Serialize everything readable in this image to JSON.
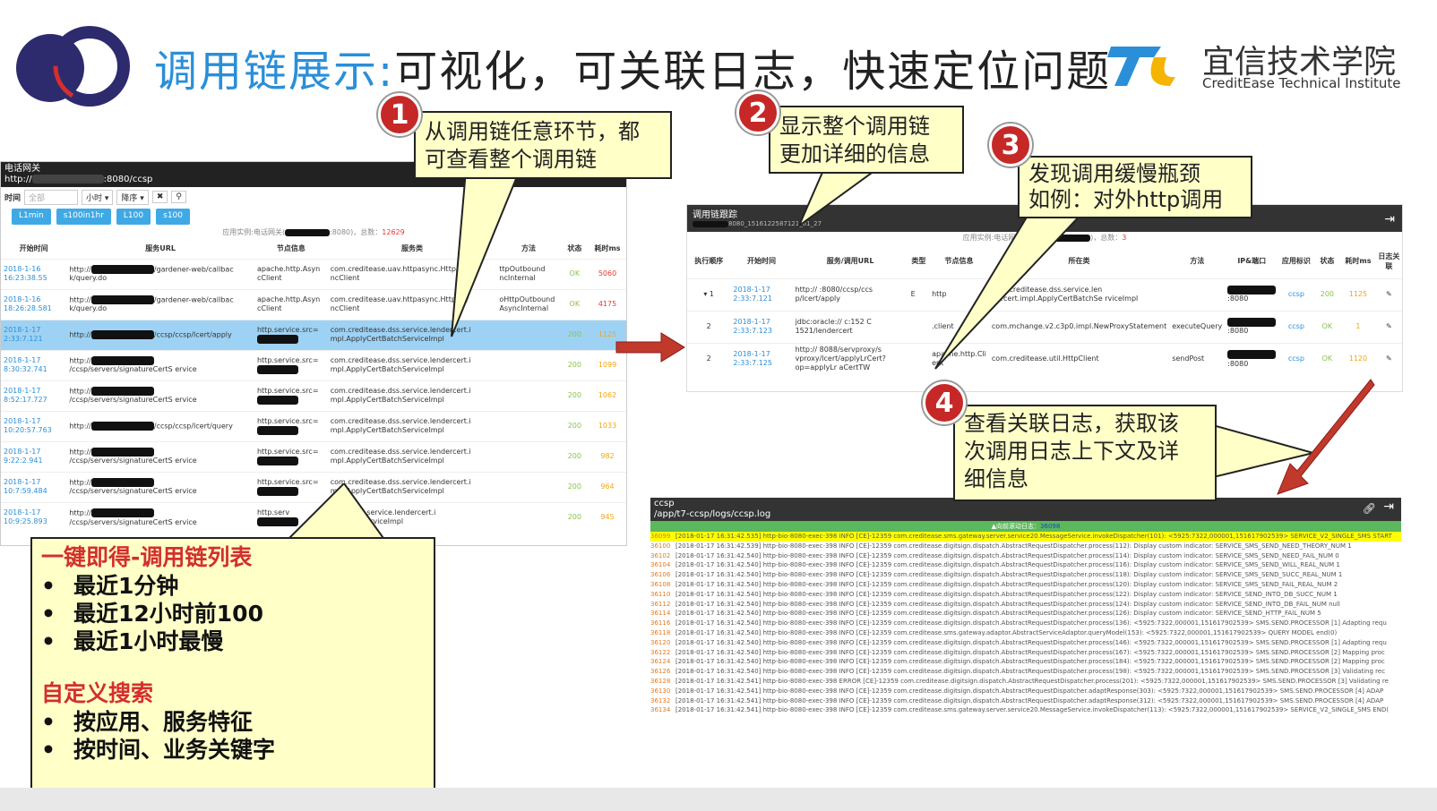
{
  "header": {
    "title_highlight": "调用链展示:",
    "title_rest": "可视化，可关联日志，快速定位问题",
    "brand_name": "宜信技术学院",
    "brand_sub": "CreditEase Technical Institute"
  },
  "panel1": {
    "head_line1": "电话网关",
    "head_line2_prefix": "http://",
    "head_line2_suffix": ":8080/ccsp",
    "search_label": "时间",
    "search_placeholder": "全部",
    "select_unit": "小时",
    "select_order": "降序",
    "quick_buttons": [
      "L1min",
      "s100in1hr",
      "L100",
      "s100"
    ],
    "info_prefix": "应用实例:电话网关(",
    "info_suffix": ":8080)，总数：",
    "info_total": "12629",
    "columns": [
      "开始时间",
      "服务URL",
      "节点信息",
      "服务类",
      "方法",
      "状态",
      "耗时ms"
    ],
    "rows": [
      {
        "time": "2018-1-16 16:23:38.55",
        "url_end": "/gardener-web/callbac k/query.do",
        "node": "apache.http.Asyn cClient",
        "cls": "com.creditease.uav.httpasync.HttpAsy ncClient",
        "method": "ttpOutbound ncInternal",
        "status": "OK",
        "ms": "5060",
        "sel": false
      },
      {
        "time": "2018-1-16 18:26:28.581",
        "url_end": "/gardener-web/callbac k/query.do",
        "node": "apache.http.Asyn cClient",
        "cls": "com.creditease.uav.httpasync.HttpAsy ncClient",
        "method": "oHttpOutbound AsyncInternal",
        "status": "OK",
        "ms": "4175",
        "sel": false
      },
      {
        "time": "2018-1-17 2:33:7.121",
        "url_end": "/ccsp/ccsp/lcert/apply",
        "node": "http.service.src=",
        "cls": "com.creditease.dss.service.lendercert.i mpl.ApplyCertBatchServiceImpl",
        "method": "",
        "status": "200",
        "ms": "1125",
        "sel": true
      },
      {
        "time": "2018-1-17 8:30:32.741",
        "url_end": "/ccsp/servers/signatureCertS ervice",
        "node": "http.service.src=",
        "cls": "com.creditease.dss.service.lendercert.i mpl.ApplyCertBatchServiceImpl",
        "method": "",
        "status": "200",
        "ms": "1099",
        "sel": false
      },
      {
        "time": "2018-1-17 8:52:17.727",
        "url_end": "/ccsp/servers/signatureCertS ervice",
        "node": "http.service.src=",
        "cls": "com.creditease.dss.service.lendercert.i mpl.ApplyCertBatchServiceImpl",
        "method": "",
        "status": "200",
        "ms": "1062",
        "sel": false
      },
      {
        "time": "2018-1-17 10:20:57.763",
        "url_end": "/ccsp/ccsp/lcert/query",
        "node": "http.service.src=",
        "cls": "com.creditease.dss.service.lendercert.i mpl.ApplyCertBatchServiceImpl",
        "method": "",
        "status": "200",
        "ms": "1033",
        "sel": false
      },
      {
        "time": "2018-1-17 9:22:2.941",
        "url_end": "/ccsp/servers/signatureCertS ervice",
        "node": "http.service.src=",
        "cls": "com.creditease.dss.service.lendercert.i mpl.ApplyCertBatchServiceImpl",
        "method": "",
        "status": "200",
        "ms": "982",
        "sel": false
      },
      {
        "time": "2018-1-17 10:7:59.484",
        "url_end": "/ccsp/servers/signatureCertS ervice",
        "node": "http.service.src=",
        "cls": "com.creditease.dss.service.lendercert.i mpl.ApplyCertBatchServiceImpl",
        "method": "",
        "status": "200",
        "ms": "964",
        "sel": false
      },
      {
        "time": "2018-1-17 10:9:25.893",
        "url_end": "/ccsp/servers/signatureCertS ervice",
        "node": "http.serv",
        "cls": "tease.dss.service.lendercert.i ertBatchServiceImpl",
        "method": "",
        "status": "200",
        "ms": "945",
        "sel": false
      }
    ]
  },
  "panel2": {
    "head_title": "调用链跟踪",
    "head_sub": "8080_1516122587121_61_27",
    "info_prefix": "应用实例:电话网关(10.",
    "info_suffix": ")，总数：",
    "info_total": "3",
    "columns": [
      "执行顺序",
      "开始时间",
      "服务/调用URL",
      "类型",
      "节点信息",
      "所在类",
      "方法",
      "IP&端口",
      "应用标识",
      "状态",
      "耗时ms",
      "日志关联"
    ],
    "rows": [
      {
        "seq": "▾ 1",
        "time": "2018-1-17 2:33:7.121",
        "url": "http:// :8080/ccsp/ccs p/lcert/apply",
        "type": "E",
        "node": "http",
        "cls": "com.creditease.dss.service.len dercert.impl.ApplyCertBatchSe rviceImpl",
        "method": "",
        "ip": ":8080",
        "app": "ccsp",
        "status": "200",
        "ms": "1125"
      },
      {
        "seq": "2",
        "time": "2018-1-17 2:33:7.123",
        "url": "jdbc:oracle:// c:152 C 1521/lendercert",
        "type": "",
        "node": ".client",
        "cls": "com.mchange.v2.c3p0.impl.NewProxyStatement",
        "method": "executeQuery",
        "ip": ":8080",
        "app": "ccsp",
        "status": "OK",
        "ms": "1"
      },
      {
        "seq": "2",
        "time": "2018-1-17 2:33:7.125",
        "url": "http:// 8088/servproxy/s vproxy/lcert/applyLrCert?op=applyLr aCertTW",
        "type": "",
        "node": "apache.http.Cli ent",
        "cls": "com.creditease.util.HttpClient",
        "method": "sendPost",
        "ip": ":8080",
        "app": "ccsp",
        "status": "OK",
        "ms": "1120"
      }
    ]
  },
  "panel3": {
    "head_app": "ccsp",
    "head_path": "/app/t7-ccsp/logs/ccsp.log",
    "bar_prefix": "向前滚动日志：",
    "bar_value": "36098",
    "logs": [
      {
        "n": "36099",
        "t": "[2018-01-17 16:31:42.535] http-bio-8080-exec-398 INFO [CE]-12359 com.creditease.sms.gateway.server.service20.MessageService.invokeDispatcher(101): <5925:7322,000001,151617902539> SERVICE_V2_SINGLE_SMS START",
        "hl": true
      },
      {
        "n": "36100",
        "t": "[2018-01-17 16:31:42.539] http-bio-8080-exec-398 INFO [CE]-12359 com.creditease.digitsign.dispatch.AbstractRequestDispatcher.process(112): Display custom indicator: SERVICE_SMS_SEND_NEED_THEORY_NUM 1",
        "hl": false
      },
      {
        "n": "36102",
        "t": "[2018-01-17 16:31:42.540] http-bio-8080-exec-398 INFO [CE]-12359 com.creditease.digitsign.dispatch.AbstractRequestDispatcher.process(114): Display custom indicator: SERVICE_SMS_SEND_NEED_FAIL_NUM 0",
        "hl": false
      },
      {
        "n": "36104",
        "t": "[2018-01-17 16:31:42.540] http-bio-8080-exec-398 INFO [CE]-12359 com.creditease.digitsign.dispatch.AbstractRequestDispatcher.process(116): Display custom indicator: SERVICE_SMS_SEND_WILL_REAL_NUM 1",
        "hl": false
      },
      {
        "n": "36106",
        "t": "[2018-01-17 16:31:42.540] http-bio-8080-exec-398 INFO [CE]-12359 com.creditease.digitsign.dispatch.AbstractRequestDispatcher.process(118): Display custom indicator: SERVICE_SMS_SEND_SUCC_REAL_NUM 1",
        "hl": false
      },
      {
        "n": "36108",
        "t": "[2018-01-17 16:31:42.540] http-bio-8080-exec-398 INFO [CE]-12359 com.creditease.digitsign.dispatch.AbstractRequestDispatcher.process(120): Display custom indicator: SERVICE_SMS_SEND_FAIL_REAL_NUM 2",
        "hl": false
      },
      {
        "n": "36110",
        "t": "[2018-01-17 16:31:42.540] http-bio-8080-exec-398 INFO [CE]-12359 com.creditease.digitsign.dispatch.AbstractRequestDispatcher.process(122): Display custom indicator: SERVICE_SEND_INTO_DB_SUCC_NUM 1",
        "hl": false
      },
      {
        "n": "36112",
        "t": "[2018-01-17 16:31:42.540] http-bio-8080-exec-398 INFO [CE]-12359 com.creditease.digitsign.dispatch.AbstractRequestDispatcher.process(124): Display custom indicator: SERVICE_SEND_INTO_DB_FAIL_NUM null",
        "hl": false
      },
      {
        "n": "36114",
        "t": "[2018-01-17 16:31:42.540] http-bio-8080-exec-398 INFO [CE]-12359 com.creditease.digitsign.dispatch.AbstractRequestDispatcher.process(126): Display custom indicator: SERVICE_SEND_HTTP_FAIL_NUM 5",
        "hl": false
      },
      {
        "n": "36116",
        "t": "[2018-01-17 16:31:42.540] http-bio-8080-exec-398 INFO [CE]-12359 com.creditease.digitsign.dispatch.AbstractRequestDispatcher.process(136): <5925:7322,000001,151617902539> SMS.SEND.PROCESSOR [1] Adapting requ",
        "hl": false
      },
      {
        "n": "36118",
        "t": "[2018-01-17 16:31:42.540] http-bio-8080-exec-398 INFO [CE]-12359 com.creditease.sms.gateway.adaptor.AbstractServiceAdaptor.queryModel(153): <5925:7322,000001,151617902539> QUERY MODEL end(0)",
        "hl": false
      },
      {
        "n": "36120",
        "t": "[2018-01-17 16:31:42.540] http-bio-8080-exec-398 INFO [CE]-12359 com.creditease.digitsign.dispatch.AbstractRequestDispatcher.process(146): <5925:7322,000001,151617902539> SMS.SEND.PROCESSOR [1] Adapting requ",
        "hl": false
      },
      {
        "n": "36122",
        "t": "[2018-01-17 16:31:42.540] http-bio-8080-exec-398 INFO [CE]-12359 com.creditease.digitsign.dispatch.AbstractRequestDispatcher.process(167): <5925:7322,000001,151617902539> SMS.SEND.PROCESSOR [2] Mapping proc",
        "hl": false
      },
      {
        "n": "36124",
        "t": "[2018-01-17 16:31:42.540] http-bio-8080-exec-398 INFO [CE]-12359 com.creditease.digitsign.dispatch.AbstractRequestDispatcher.process(184): <5925:7322,000001,151617902539> SMS.SEND.PROCESSOR [2] Mapping proc",
        "hl": false
      },
      {
        "n": "36126",
        "t": "[2018-01-17 16:31:42.540] http-bio-8080-exec-398 INFO [CE]-12359 com.creditease.digitsign.dispatch.AbstractRequestDispatcher.process(198): <5925:7322,000001,151617902539> SMS.SEND.PROCESSOR [3] Validating rec",
        "hl": false
      },
      {
        "n": "36128",
        "t": "[2018-01-17 16:31:42.541] http-bio-8080-exec-398 ERROR [CE]-12359 com.creditease.digitsign.dispatch.AbstractRequestDispatcher.process(201): <5925:7322,000001,151617902539> SMS.SEND.PROCESSOR [3] Validating re",
        "hl": false
      },
      {
        "n": "36130",
        "t": "[2018-01-17 16:31:42.541] http-bio-8080-exec-398 INFO [CE]-12359 com.creditease.digitsign.dispatch.AbstractRequestDispatcher.adaptResponse(303): <5925:7322,000001,151617902539> SMS.SEND.PROCESSOR [4] ADAP",
        "hl": false
      },
      {
        "n": "36132",
        "t": "[2018-01-17 16:31:42.541] http-bio-8080-exec-398 INFO [CE]-12359 com.creditease.digitsign.dispatch.AbstractRequestDispatcher.adaptResponse(312): <5925:7322,000001,151617902539> SMS.SEND.PROCESSOR [4] ADAP",
        "hl": false
      },
      {
        "n": "36134",
        "t": "[2018-01-17 16:31:42.541] http-bio-8080-exec-398 INFO [CE]-12359 com.creditease.sms.gateway.server.service20.MessageService.invokeDispatcher(113): <5925:7322,000001,151617902539> SERVICE_V2_SINGLE_SMS END(",
        "hl": false
      }
    ]
  },
  "callouts": {
    "c1_line1": "从调用链任意环节，都",
    "c1_line2": "可查看整个调用链",
    "c2_line1": "显示整个调用链",
    "c2_line2": "更加详细的信息",
    "c3_line1": "发现调用缓慢瓶颈",
    "c3_line2": "如例：对外http调用",
    "c4_line1": "查看关联日志，获取该",
    "c4_line2": "次调用日志上下文及详",
    "c4_line3": "细信息",
    "badges": [
      "1",
      "2",
      "3",
      "4"
    ]
  },
  "summary": {
    "heading1": "一键即得-调用链列表",
    "items1": [
      "最近1分钟",
      "最近12小时前100",
      "最近1小时最慢"
    ],
    "heading2": "自定义搜索",
    "items2": [
      "按应用、服务特征",
      "按时间、业务关键字"
    ]
  },
  "colors": {
    "accent": "#2a8fd8",
    "callout_bg": "#ffffc8",
    "badge": "#c62828",
    "arrow": "#c0392b"
  }
}
